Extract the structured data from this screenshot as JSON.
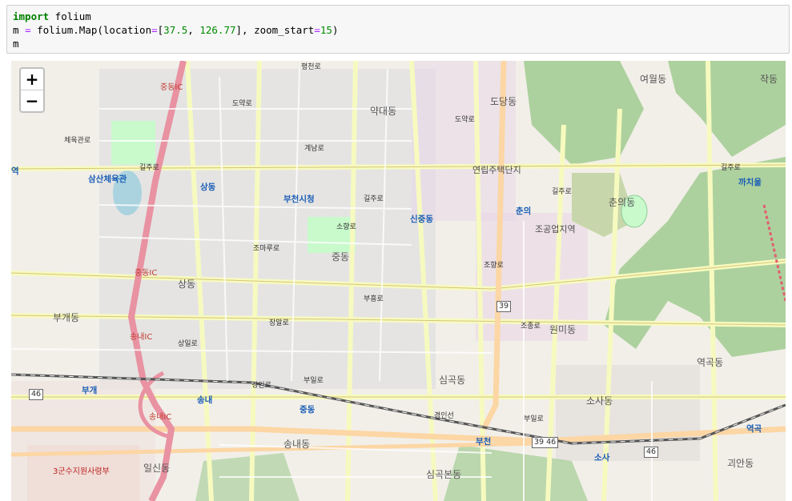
{
  "code": {
    "line1_kw": "import",
    "line1_rest": " folium",
    "line2_a": "m ",
    "line2_eq": "=",
    "line2_b": " folium.Map(location",
    "line2_eq2": "=",
    "line2_c": "[",
    "line2_n1": "37.5",
    "line2_d": ", ",
    "line2_n2": "126.77",
    "line2_e": "], zoom_start",
    "line2_eq3": "=",
    "line2_n3": "15",
    "line2_f": ")",
    "line3": "m"
  },
  "map": {
    "zoom_in": "+",
    "zoom_out": "−",
    "districts": [
      "약대동",
      "도당동",
      "여월동",
      "작동",
      "상동",
      "중동",
      "상동",
      "부개동",
      "원미동",
      "춘의동",
      "심곡동",
      "송내동",
      "일신동",
      "심곡본동",
      "소사동",
      "역곡동",
      "괴안동"
    ],
    "stations": [
      "삼산체육관",
      "부천시청",
      "신중동",
      "춘의",
      "상동",
      "송내",
      "중동",
      "부천",
      "소사",
      "까치울",
      "역곡",
      "부개",
      "역"
    ],
    "roads": [
      "길주로",
      "길주로",
      "길주로",
      "길주로",
      "조마루로",
      "부흥로",
      "장말로",
      "부일로",
      "경인로",
      "평천로",
      "도약로",
      "계남로",
      "소향로",
      "도약로",
      "조종로",
      "조향로",
      "경인선",
      "부일로",
      "상일로",
      "체육관로"
    ],
    "special": [
      "연립주택단지",
      "조공업지역",
      "3군수지원사령부"
    ],
    "ics": [
      "중동IC",
      "중동IC",
      "송내IC",
      "송내IC"
    ],
    "shields": [
      "46",
      "39",
      "39 46",
      "46"
    ],
    "colors": {
      "motorway": "#e892a2",
      "primary": "#fcd6a4",
      "secondary": "#f7fabf",
      "forest": "#add19e",
      "park": "#c8facc",
      "residential": "#e0dfdf"
    }
  }
}
